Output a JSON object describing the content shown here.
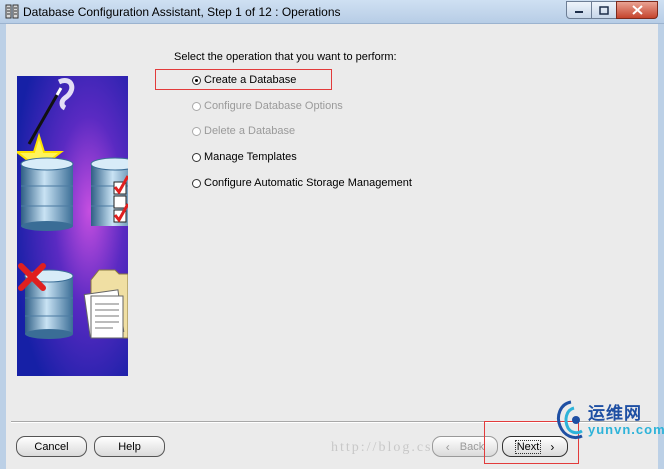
{
  "window": {
    "title": "Database Configuration Assistant, Step 1 of 12 : Operations"
  },
  "prompt": "Select the operation that you want to perform:",
  "options": [
    {
      "label": "Create a Database",
      "checked": true,
      "enabled": true
    },
    {
      "label": "Configure Database Options",
      "checked": false,
      "enabled": false
    },
    {
      "label": "Delete a Database",
      "checked": false,
      "enabled": false
    },
    {
      "label": "Manage Templates",
      "checked": false,
      "enabled": true
    },
    {
      "label": "Configure Automatic Storage Management",
      "checked": false,
      "enabled": true
    }
  ],
  "buttons": {
    "cancel": "Cancel",
    "help": "Help",
    "back": "Back",
    "next": "Next"
  },
  "watermark": "http://blog.csdn",
  "logo": {
    "chinese": "运维网",
    "domain": "yunvn.com"
  },
  "colors": {
    "highlight": "#e23b3b",
    "illustration_blue": "#1c2aa8",
    "logo_blue": "#1e4fa3",
    "logo_cyan": "#2db3d9"
  },
  "icons": [
    "app-icon",
    "minimize-icon",
    "maximize-icon",
    "close-icon",
    "wand-icon",
    "star-icon",
    "database-icon",
    "checklist-icon",
    "delete-x-icon",
    "folder-icon",
    "back-chevron-icon",
    "next-chevron-icon"
  ]
}
